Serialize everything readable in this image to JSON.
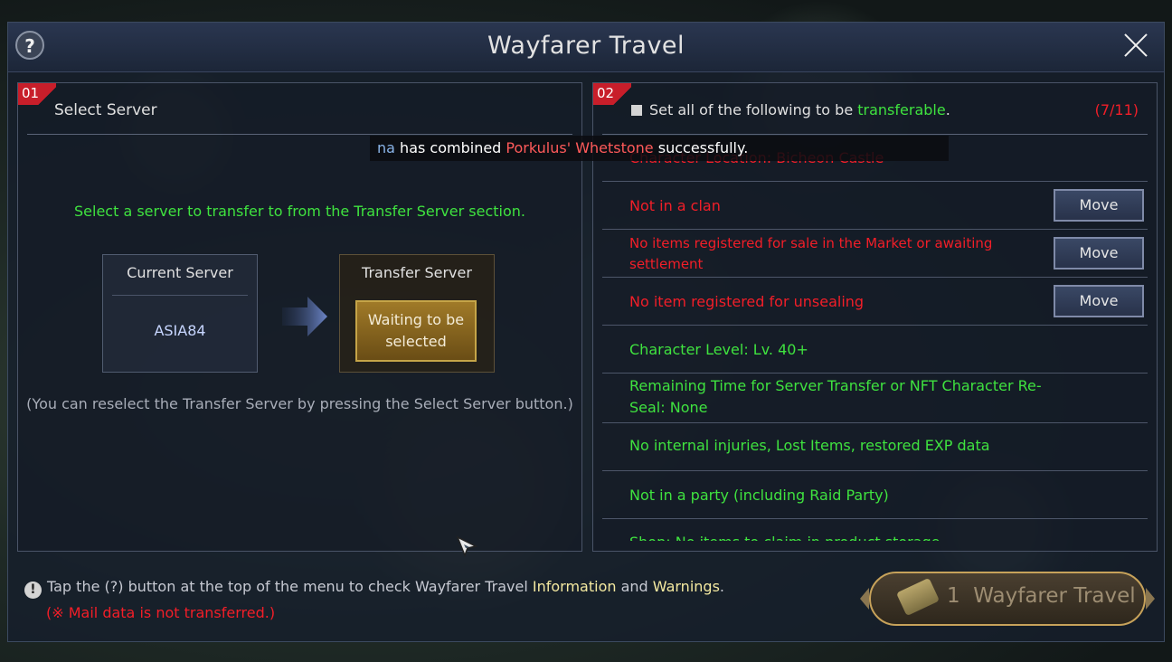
{
  "window": {
    "title": "Wayfarer Travel",
    "help_label": "?"
  },
  "left_panel": {
    "number": "01",
    "title": "Select Server",
    "instruction": "Select a server to transfer to from the Transfer Server section.",
    "current_server_label": "Current Server",
    "current_server_value": "ASIA84",
    "transfer_server_label": "Transfer Server",
    "transfer_server_button": "Waiting to be selected",
    "reselect_note": "(You can reselect the Transfer Server by pressing the Select Server button.)"
  },
  "right_panel": {
    "number": "02",
    "set_all_prefix": "Set all of the following to be ",
    "set_all_keyword": "transferable",
    "set_all_suffix": ".",
    "count": "(7/11)",
    "rows": [
      {
        "text": "Character Location: Bicheon Castle",
        "status": "red",
        "button": ""
      },
      {
        "text": "Not in a clan",
        "status": "red",
        "button": "Move"
      },
      {
        "text": "No items registered for sale in the Market or awaiting settlement",
        "status": "red",
        "button": "Move"
      },
      {
        "text": "No item registered for unsealing",
        "status": "red",
        "button": "Move"
      },
      {
        "text": "Character Level: Lv. 40+",
        "status": "green",
        "button": ""
      },
      {
        "text": "Remaining Time for Server Transfer or NFT Character Re-Seal: None",
        "status": "green",
        "button": ""
      },
      {
        "text": "No internal injuries, Lost Items, restored EXP data",
        "status": "green",
        "button": ""
      },
      {
        "text": "Not in a party (including Raid Party)",
        "status": "green",
        "button": ""
      },
      {
        "text": "Shop: No items to claim in product storage",
        "status": "green",
        "button": ""
      }
    ]
  },
  "toast": {
    "name": "na",
    "text_a": "has combined",
    "item": "Porkulus' Whetstone",
    "text_b": "successfully."
  },
  "footer": {
    "info_a": "Tap the (?) button at the top of the menu to check Wayfarer Travel ",
    "info_link1": "Information",
    "info_and": " and ",
    "info_link2": "Warnings",
    "info_end": ".",
    "warning": "(※ Mail data is not transferred.)"
  },
  "travel_button": {
    "count": "1",
    "label": "Wayfarer Travel"
  },
  "colors": {
    "green": "#3fe23f",
    "red": "#f21e28",
    "gold": "#c6a548",
    "info_yellow": "#f4e9a0"
  },
  "icons": [
    "help-icon",
    "close-icon",
    "arrow-right-icon",
    "cursor-icon",
    "info-icon",
    "ticket-icon"
  ]
}
